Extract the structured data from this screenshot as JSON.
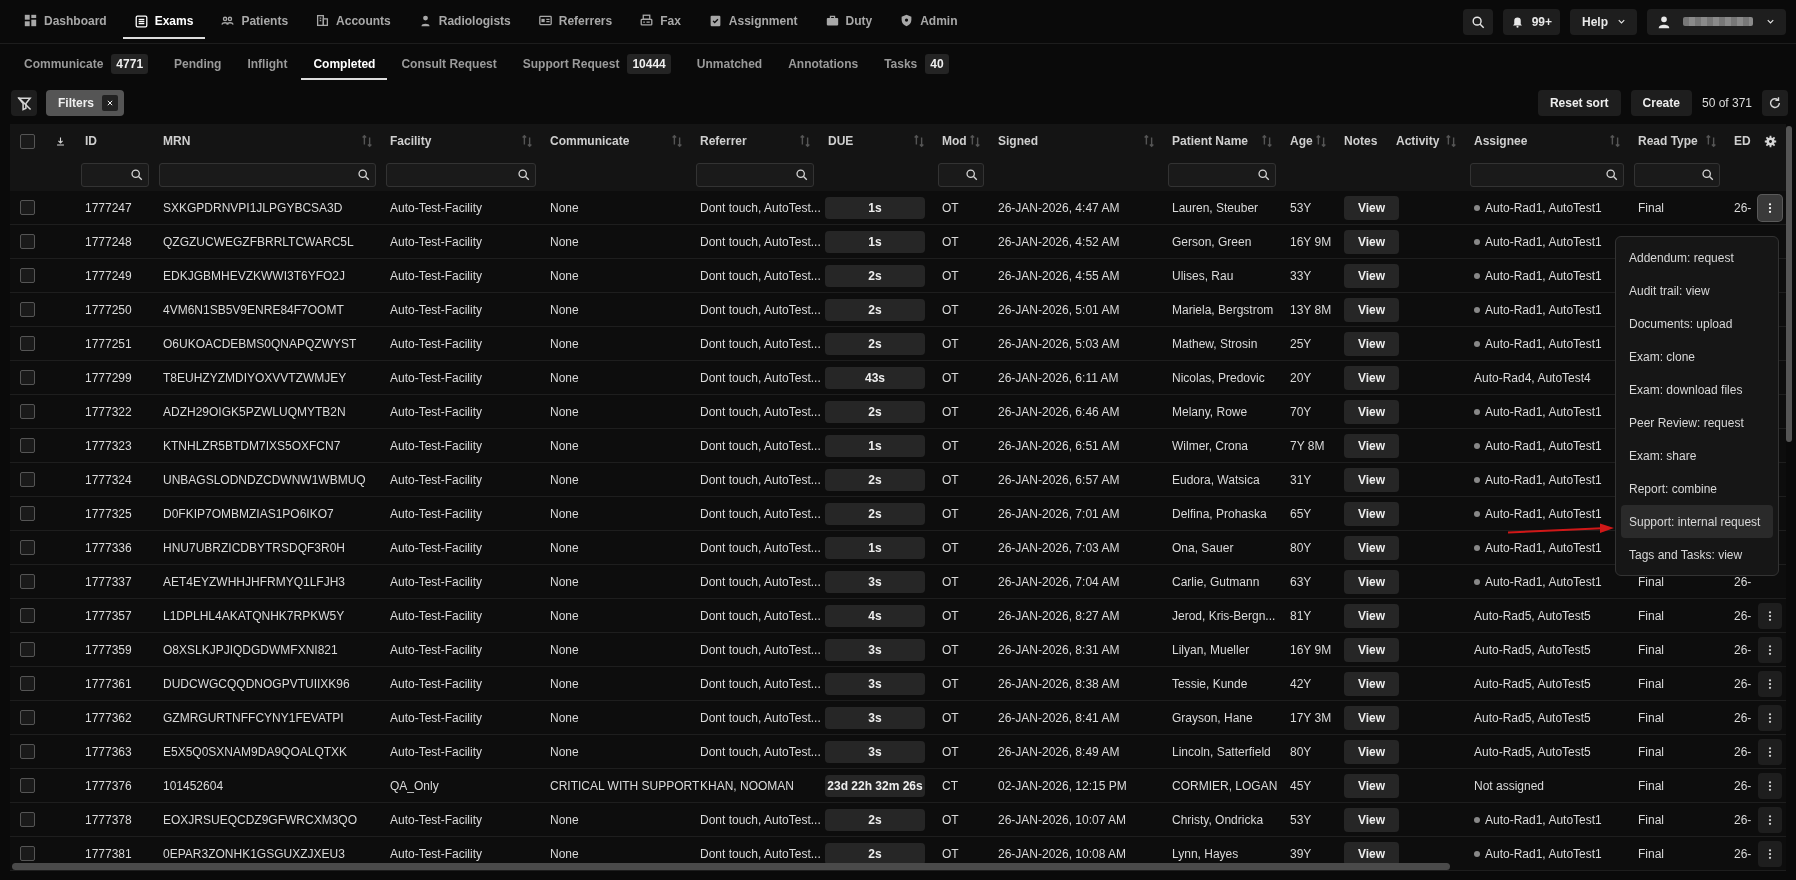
{
  "nav": {
    "items": [
      {
        "label": "Dashboard",
        "selected": false
      },
      {
        "label": "Exams",
        "selected": true
      },
      {
        "label": "Patients",
        "selected": false
      },
      {
        "label": "Accounts",
        "selected": false
      },
      {
        "label": "Radiologists",
        "selected": false
      },
      {
        "label": "Referrers",
        "selected": false
      },
      {
        "label": "Fax",
        "selected": false
      },
      {
        "label": "Assignment",
        "selected": false
      },
      {
        "label": "Duty",
        "selected": false
      },
      {
        "label": "Admin",
        "selected": false
      }
    ],
    "notifications": "99+",
    "help": "Help"
  },
  "subtabs": [
    {
      "label": "Communicate",
      "count": "4771",
      "selected": false
    },
    {
      "label": "Pending",
      "selected": false
    },
    {
      "label": "Inflight",
      "selected": false
    },
    {
      "label": "Completed",
      "selected": true
    },
    {
      "label": "Consult Request",
      "selected": false
    },
    {
      "label": "Support Request",
      "count": "10444",
      "selected": false
    },
    {
      "label": "Unmatched",
      "selected": false
    },
    {
      "label": "Annotations",
      "selected": false
    },
    {
      "label": "Tasks",
      "count": "40",
      "selected": false
    }
  ],
  "toolbar": {
    "filter_chip": "Filters",
    "buttons": [
      "Reset sort",
      "Create"
    ],
    "count": "50 of 371"
  },
  "table": {
    "select_all_checked": false,
    "columns": [
      {
        "label": "ID",
        "sortable": false,
        "filter": true
      },
      {
        "label": "MRN",
        "sortable": true,
        "filter": true
      },
      {
        "label": "Facility",
        "sortable": true,
        "filter": true
      },
      {
        "label": "Communicate",
        "sortable": true,
        "filter": false
      },
      {
        "label": "Referrer",
        "sortable": true,
        "filter": true
      },
      {
        "label": "DUE",
        "sortable": true,
        "filter": false
      },
      {
        "label": "Mod",
        "sortable": true,
        "filter": true
      },
      {
        "label": "Signed",
        "sortable": true,
        "filter": false
      },
      {
        "label": "Patient Name",
        "sortable": true,
        "filter": true
      },
      {
        "label": "Age",
        "sortable": true,
        "filter": false
      },
      {
        "label": "Notes",
        "sortable": false,
        "filter": false
      },
      {
        "label": "Activity",
        "sortable": true,
        "filter": false
      },
      {
        "label": "Assignee",
        "sortable": true,
        "filter": true
      },
      {
        "label": "Read Type",
        "sortable": true,
        "filter": true
      },
      {
        "label": "ED",
        "sortable": false,
        "filter": false
      }
    ],
    "rows": [
      {
        "checked": false,
        "id": "1777247",
        "mrn": "SXKGPDRNVPI1JLPGYBCSA3D",
        "facility": "Auto-Test-Facility",
        "communicate": "None",
        "referrer": "Dont touch, AutoTest...",
        "due": "1s",
        "mod": "OT",
        "signed": "26-JAN-2026, 4:47 AM",
        "patient_name": "Lauren, Steuber",
        "age": "53Y",
        "notes": "View",
        "assignee": "Auto-Rad1, AutoTest1",
        "assignee_dot": true,
        "read_type": "Final",
        "ed": "26-",
        "menu_open": true
      },
      {
        "checked": false,
        "id": "1777248",
        "mrn": "QZGZUCWEGZFBRRLTCWARC5L",
        "facility": "Auto-Test-Facility",
        "communicate": "None",
        "referrer": "Dont touch, AutoTest...",
        "due": "1s",
        "mod": "OT",
        "signed": "26-JAN-2026, 4:52 AM",
        "patient_name": "Gerson, Green",
        "age": "16Y 9M",
        "notes": "View",
        "assignee": "Auto-Rad1, AutoTest1",
        "assignee_dot": true
      },
      {
        "checked": false,
        "id": "1777249",
        "mrn": "EDKJGBMHEVZKWWI3T6YFO2J",
        "facility": "Auto-Test-Facility",
        "communicate": "None",
        "referrer": "Dont touch, AutoTest...",
        "due": "2s",
        "mod": "OT",
        "signed": "26-JAN-2026, 4:55 AM",
        "patient_name": "Ulises, Rau",
        "age": "33Y",
        "notes": "View",
        "assignee": "Auto-Rad1, AutoTest1",
        "assignee_dot": true
      },
      {
        "checked": false,
        "id": "1777250",
        "mrn": "4VM6N1SB5V9ENRE84F7OOMT",
        "facility": "Auto-Test-Facility",
        "communicate": "None",
        "referrer": "Dont touch, AutoTest...",
        "due": "2s",
        "mod": "OT",
        "signed": "26-JAN-2026, 5:01 AM",
        "patient_name": "Mariela, Bergstrom",
        "age": "13Y 8M",
        "notes": "View",
        "assignee": "Auto-Rad1, AutoTest1",
        "assignee_dot": true
      },
      {
        "checked": false,
        "id": "1777251",
        "mrn": "O6UKOACDEBMS0QNAPQZWYST",
        "facility": "Auto-Test-Facility",
        "communicate": "None",
        "referrer": "Dont touch, AutoTest...",
        "due": "2s",
        "mod": "OT",
        "signed": "26-JAN-2026, 5:03 AM",
        "patient_name": "Mathew, Strosin",
        "age": "25Y",
        "notes": "View",
        "assignee": "Auto-Rad1, AutoTest1",
        "assignee_dot": true
      },
      {
        "checked": false,
        "id": "1777299",
        "mrn": "T8EUHZYZMDIYOXVVTZWMJEY",
        "facility": "Auto-Test-Facility",
        "communicate": "None",
        "referrer": "Dont touch, AutoTest...",
        "due": "43s",
        "mod": "OT",
        "signed": "26-JAN-2026, 6:11 AM",
        "patient_name": "Nicolas, Predovic",
        "age": "20Y",
        "notes": "View",
        "assignee": "Auto-Rad4, AutoTest4",
        "assignee_dot": false
      },
      {
        "checked": false,
        "id": "1777322",
        "mrn": "ADZH29OIGK5PZWLUQMYTB2N",
        "facility": "Auto-Test-Facility",
        "communicate": "None",
        "referrer": "Dont touch, AutoTest...",
        "due": "2s",
        "mod": "OT",
        "signed": "26-JAN-2026, 6:46 AM",
        "patient_name": "Melany, Rowe",
        "age": "70Y",
        "notes": "View",
        "assignee": "Auto-Rad1, AutoTest1",
        "assignee_dot": true
      },
      {
        "checked": false,
        "id": "1777323",
        "mrn": "KTNHLZR5BTDM7IXS5OXFCN7",
        "facility": "Auto-Test-Facility",
        "communicate": "None",
        "referrer": "Dont touch, AutoTest...",
        "due": "1s",
        "mod": "OT",
        "signed": "26-JAN-2026, 6:51 AM",
        "patient_name": "Wilmer, Crona",
        "age": "7Y 8M",
        "notes": "View",
        "assignee": "Auto-Rad1, AutoTest1",
        "assignee_dot": true
      },
      {
        "checked": false,
        "id": "1777324",
        "mrn": "UNBAGSLODNDZCDWNW1WBMUQ",
        "facility": "Auto-Test-Facility",
        "communicate": "None",
        "referrer": "Dont touch, AutoTest...",
        "due": "2s",
        "mod": "OT",
        "signed": "26-JAN-2026, 6:57 AM",
        "patient_name": "Eudora, Watsica",
        "age": "31Y",
        "notes": "View",
        "assignee": "Auto-Rad1, AutoTest1",
        "assignee_dot": true
      },
      {
        "checked": false,
        "id": "1777325",
        "mrn": "D0FKIP7OMBMZIAS1PO6IKO7",
        "facility": "Auto-Test-Facility",
        "communicate": "None",
        "referrer": "Dont touch, AutoTest...",
        "due": "2s",
        "mod": "OT",
        "signed": "26-JAN-2026, 7:01 AM",
        "patient_name": "Delfina, Prohaska",
        "age": "65Y",
        "notes": "View",
        "assignee": "Auto-Rad1, AutoTest1",
        "assignee_dot": true
      },
      {
        "checked": false,
        "id": "1777336",
        "mrn": "HNU7UBRZICDBYTRSDQF3R0H",
        "facility": "Auto-Test-Facility",
        "communicate": "None",
        "referrer": "Dont touch, AutoTest...",
        "due": "1s",
        "mod": "OT",
        "signed": "26-JAN-2026, 7:03 AM",
        "patient_name": "Ona, Sauer",
        "age": "80Y",
        "notes": "View",
        "assignee": "Auto-Rad1, AutoTest1",
        "assignee_dot": true
      },
      {
        "checked": false,
        "id": "1777337",
        "mrn": "AET4EYZWHHJHFRMYQ1LFJH3",
        "facility": "Auto-Test-Facility",
        "communicate": "None",
        "referrer": "Dont touch, AutoTest...",
        "due": "3s",
        "mod": "OT",
        "signed": "26-JAN-2026, 7:04 AM",
        "patient_name": "Carlie, Gutmann",
        "age": "63Y",
        "notes": "View",
        "assignee": "Auto-Rad1, AutoTest1",
        "assignee_dot": true,
        "read_type": "Final",
        "ed": "26-"
      },
      {
        "checked": false,
        "id": "1777357",
        "mrn": "L1DPLHL4AKATQNHK7RPKW5Y",
        "facility": "Auto-Test-Facility",
        "communicate": "None",
        "referrer": "Dont touch, AutoTest...",
        "due": "4s",
        "mod": "OT",
        "signed": "26-JAN-2026, 8:27 AM",
        "patient_name": "Jerod, Kris-Bergn...",
        "age": "81Y",
        "notes": "View",
        "assignee": "Auto-Rad5, AutoTest5",
        "assignee_dot": false,
        "read_type": "Final",
        "ed": "26-",
        "menu_open": false
      },
      {
        "checked": false,
        "id": "1777359",
        "mrn": "O8XSLKJPJIQDGDWMFXNI821",
        "facility": "Auto-Test-Facility",
        "communicate": "None",
        "referrer": "Dont touch, AutoTest...",
        "due": "3s",
        "mod": "OT",
        "signed": "26-JAN-2026, 8:31 AM",
        "patient_name": "Lilyan, Mueller",
        "age": "16Y 9M",
        "notes": "View",
        "assignee": "Auto-Rad5, AutoTest5",
        "assignee_dot": false,
        "read_type": "Final",
        "ed": "26-",
        "menu_open": false
      },
      {
        "checked": false,
        "id": "1777361",
        "mrn": "DUDCWGCQQDNOGPVTUIIXK96",
        "facility": "Auto-Test-Facility",
        "communicate": "None",
        "referrer": "Dont touch, AutoTest...",
        "due": "3s",
        "mod": "OT",
        "signed": "26-JAN-2026, 8:38 AM",
        "patient_name": "Tessie, Kunde",
        "age": "42Y",
        "notes": "View",
        "assignee": "Auto-Rad5, AutoTest5",
        "assignee_dot": false,
        "read_type": "Final",
        "ed": "26-",
        "menu_open": false
      },
      {
        "checked": false,
        "id": "1777362",
        "mrn": "GZMRGURTNFFCYNY1FEVATPI",
        "facility": "Auto-Test-Facility",
        "communicate": "None",
        "referrer": "Dont touch, AutoTest...",
        "due": "3s",
        "mod": "OT",
        "signed": "26-JAN-2026, 8:41 AM",
        "patient_name": "Grayson, Hane",
        "age": "17Y 3M",
        "notes": "View",
        "assignee": "Auto-Rad5, AutoTest5",
        "assignee_dot": false,
        "read_type": "Final",
        "ed": "26-",
        "menu_open": false
      },
      {
        "checked": false,
        "id": "1777363",
        "mrn": "E5X5Q0SXNAM9DA9QOALQTXK",
        "facility": "Auto-Test-Facility",
        "communicate": "None",
        "referrer": "Dont touch, AutoTest...",
        "due": "3s",
        "mod": "OT",
        "signed": "26-JAN-2026, 8:49 AM",
        "patient_name": "Lincoln, Satterfield",
        "age": "80Y",
        "notes": "View",
        "assignee": "Auto-Rad5, AutoTest5",
        "assignee_dot": false,
        "read_type": "Final",
        "ed": "26-",
        "menu_open": false
      },
      {
        "checked": false,
        "id": "1777376",
        "mrn": "101452604",
        "facility": "QA_Only",
        "communicate": "CRITICAL WITH SUPPORT",
        "referrer": "KHAN, NOOMAN",
        "due": "23d 22h 32m 26s",
        "mod": "CT",
        "signed": "02-JAN-2026, 12:15 PM",
        "patient_name": "CORMIER, LOGAN",
        "age": "45Y",
        "notes": "View",
        "assignee": "Not assigned",
        "assignee_dot": false,
        "read_type": "Final",
        "ed": "26-",
        "menu_open": false
      },
      {
        "checked": false,
        "id": "1777378",
        "mrn": "EOXJRSUEQCDZ9GFWRCXM3QO",
        "facility": "Auto-Test-Facility",
        "communicate": "None",
        "referrer": "Dont touch, AutoTest...",
        "due": "2s",
        "mod": "OT",
        "signed": "26-JAN-2026, 10:07 AM",
        "patient_name": "Christy, Ondricka",
        "age": "53Y",
        "notes": "View",
        "assignee": "Auto-Rad1, AutoTest1",
        "assignee_dot": true,
        "read_type": "Final",
        "ed": "26-",
        "menu_open": false
      },
      {
        "checked": false,
        "id": "1777381",
        "mrn": "0EPAR3ZONHK1GSGUXZJXEU3",
        "facility": "Auto-Test-Facility",
        "communicate": "None",
        "referrer": "Dont touch, AutoTest...",
        "due": "2s",
        "mod": "OT",
        "signed": "26-JAN-2026, 10:08 AM",
        "patient_name": "Lynn, Hayes",
        "age": "39Y",
        "notes": "View",
        "assignee": "Auto-Rad1, AutoTest1",
        "assignee_dot": true,
        "read_type": "Final",
        "ed": "26-",
        "menu_open": false
      }
    ]
  },
  "row_menu": {
    "pointer_arrow": true,
    "items": [
      {
        "label": "Addendum: request",
        "highlighted": false
      },
      {
        "label": "Audit trail: view",
        "highlighted": false
      },
      {
        "label": "Documents: upload",
        "highlighted": false
      },
      {
        "label": "Exam: clone",
        "highlighted": false
      },
      {
        "label": "Exam: download files",
        "highlighted": false
      },
      {
        "label": "Peer Review: request",
        "highlighted": false
      },
      {
        "label": "Exam: share",
        "highlighted": false
      },
      {
        "label": "Report: combine",
        "highlighted": false
      },
      {
        "label": "Support: internal request",
        "highlighted": true
      },
      {
        "label": "Tags and Tasks: view",
        "highlighted": false
      }
    ]
  }
}
